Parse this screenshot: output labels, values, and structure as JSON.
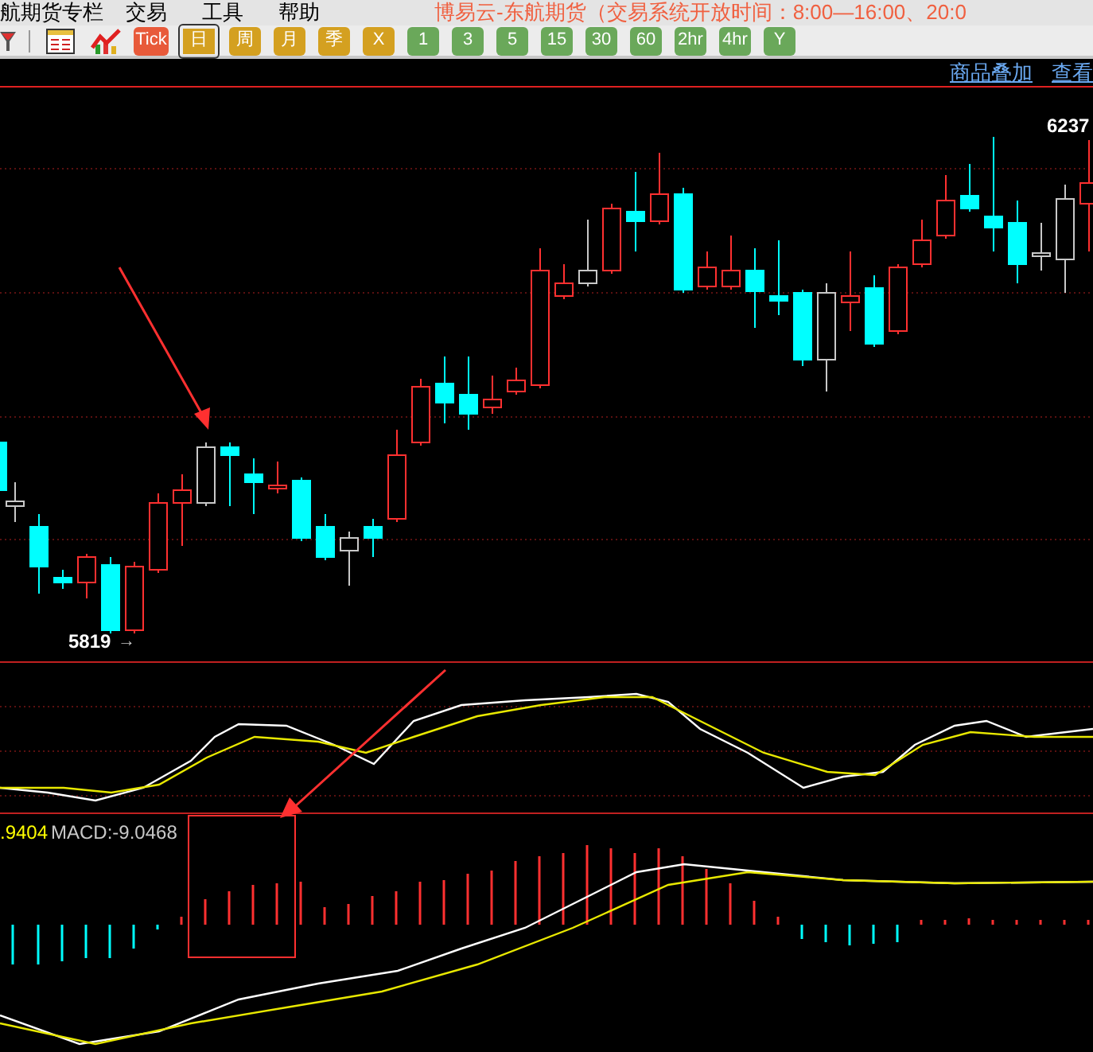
{
  "menu": [
    {
      "label": "航期货专栏"
    },
    {
      "label": "交易"
    },
    {
      "label": "工具"
    },
    {
      "label": "帮助"
    }
  ],
  "title": "博易云-东航期货（交易系统开放时间：8:00—16:00、20:0",
  "toolbar": [
    {
      "label": "Tick",
      "kind": "tick",
      "selected": false
    },
    {
      "label": "日",
      "kind": "gold",
      "selected": true
    },
    {
      "label": "周",
      "kind": "gold",
      "selected": false
    },
    {
      "label": "月",
      "kind": "gold",
      "selected": false
    },
    {
      "label": "季",
      "kind": "gold",
      "selected": false
    },
    {
      "label": "X",
      "kind": "gold",
      "selected": false
    },
    {
      "label": "1",
      "kind": "green",
      "selected": false
    },
    {
      "label": "3",
      "kind": "green",
      "selected": false
    },
    {
      "label": "5",
      "kind": "green",
      "selected": false
    },
    {
      "label": "15",
      "kind": "green",
      "selected": false
    },
    {
      "label": "30",
      "kind": "green",
      "selected": false
    },
    {
      "label": "60",
      "kind": "green",
      "selected": false
    },
    {
      "label": "2hr",
      "kind": "green",
      "selected": false
    },
    {
      "label": "4hr",
      "kind": "green",
      "selected": false
    },
    {
      "label": "Y",
      "kind": "green",
      "selected": false
    }
  ],
  "links": [
    "商品叠加",
    "查看"
  ],
  "chart": {
    "high_label": "6237",
    "low_label": "5819",
    "low_arrow": "→"
  },
  "macd_readout": [
    {
      "text": ".9404",
      "color": "#ffff00"
    },
    {
      "text": "MACD:-9.0468",
      "color": "#c8c8c8"
    }
  ]
}
